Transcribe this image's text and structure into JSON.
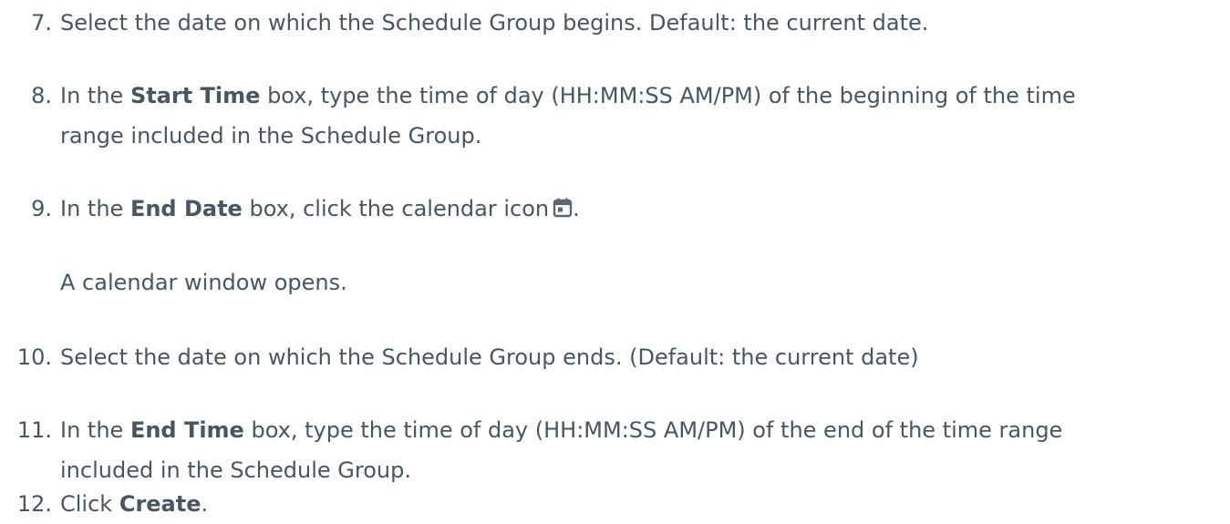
{
  "steps": [
    {
      "number": "7.",
      "lines": [
        {
          "parts": [
            "Select the date on which the Schedule Group begins. Default: the current date."
          ]
        }
      ]
    },
    {
      "number": "8.",
      "lines": [
        {
          "pre": "In the ",
          "bold": "Start Time",
          "post": " box, type the time of day (HH:MM:SS AM/PM) of the beginning of the time"
        },
        {
          "parts": [
            "range included in the Schedule Group."
          ]
        }
      ]
    },
    {
      "number": "9.",
      "lines": [
        {
          "pre": "In the ",
          "bold": "End Date",
          "post": " box, click the calendar icon",
          "after_icon": "."
        }
      ],
      "note": "A calendar window opens."
    },
    {
      "number": "10.",
      "lines": [
        {
          "parts": [
            "Select the date on which the Schedule Group ends. (Default: the current date)"
          ]
        }
      ]
    },
    {
      "number": "11.",
      "lines": [
        {
          "pre": "In the ",
          "bold": "End Time",
          "post": " box, type the time of day (HH:MM:SS AM/PM) of the end of the time range"
        },
        {
          "parts": [
            "included in the Schedule Group."
          ]
        }
      ]
    },
    {
      "number": "12.",
      "lines": [
        {
          "pre": "Click ",
          "bold": "Create",
          "post": "."
        }
      ]
    }
  ],
  "icons": {
    "calendar": "calendar-icon"
  },
  "colors": {
    "text": "#4a5560",
    "icon": "#5b6670"
  }
}
